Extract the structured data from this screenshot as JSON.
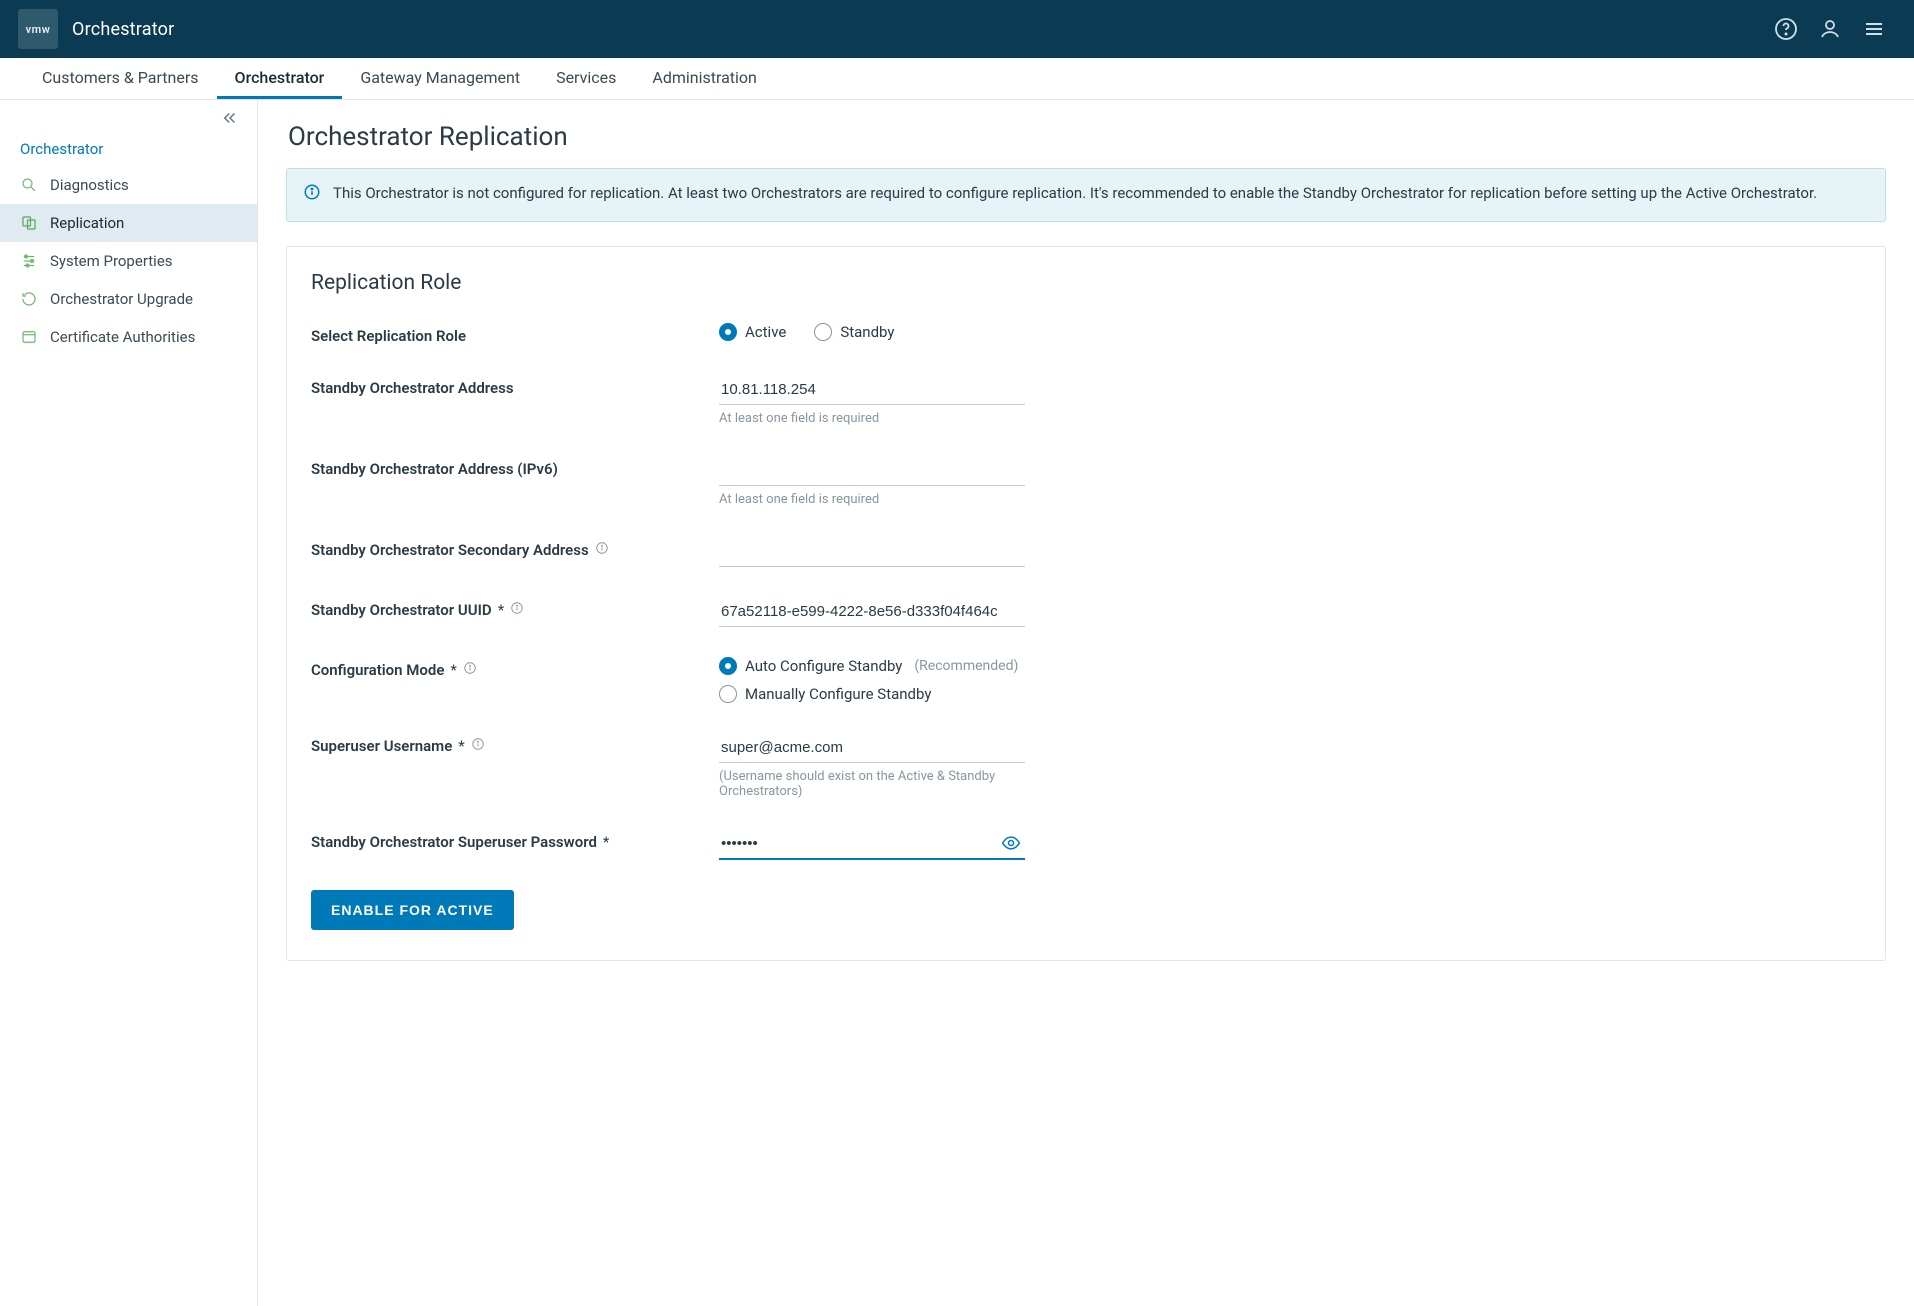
{
  "header": {
    "logo_text": "vmw",
    "brand": "Orchestrator"
  },
  "topnav": {
    "tabs": [
      {
        "label": "Customers & Partners"
      },
      {
        "label": "Orchestrator"
      },
      {
        "label": "Gateway Management"
      },
      {
        "label": "Services"
      },
      {
        "label": "Administration"
      }
    ],
    "active_index": 1
  },
  "sidebar": {
    "title": "Orchestrator",
    "items": [
      {
        "label": "Diagnostics"
      },
      {
        "label": "Replication"
      },
      {
        "label": "System Properties"
      },
      {
        "label": "Orchestrator Upgrade"
      },
      {
        "label": "Certificate Authorities"
      }
    ],
    "active_index": 1
  },
  "page": {
    "title": "Orchestrator Replication",
    "banner": "This Orchestrator is not configured for replication. At least two Orchestrators are required to configure replication. It's recommended to enable the Standby Orchestrator for replication before setting up the Active Orchestrator."
  },
  "form": {
    "section_title": "Replication Role",
    "role_label": "Select Replication Role",
    "role_options": {
      "active": "Active",
      "standby": "Standby"
    },
    "role_selected": "active",
    "address": {
      "label": "Standby Orchestrator Address",
      "value": "10.81.118.254",
      "hint": "At least one field is required"
    },
    "address6": {
      "label": "Standby Orchestrator Address (IPv6)",
      "value": "",
      "hint": "At least one field is required"
    },
    "secondary": {
      "label": "Standby Orchestrator Secondary Address",
      "value": ""
    },
    "uuid": {
      "label": "Standby Orchestrator UUID",
      "required": "*",
      "value": "67a52118-e599-4222-8e56-d333f04f464c"
    },
    "mode": {
      "label": "Configuration Mode ",
      "required": "*",
      "auto_label": "Auto Configure Standby",
      "auto_sub": "(Recommended)",
      "manual_label": "Manually Configure Standby",
      "selected": "auto"
    },
    "username": {
      "label": "Superuser Username",
      "required": "*",
      "value": "super@acme.com",
      "hint": "(Username should exist on the Active & Standby Orchestrators)"
    },
    "password": {
      "label": "Standby Orchestrator Superuser Password",
      "required": "*",
      "value": "•••••••"
    },
    "submit_label": "Enable for Active"
  }
}
